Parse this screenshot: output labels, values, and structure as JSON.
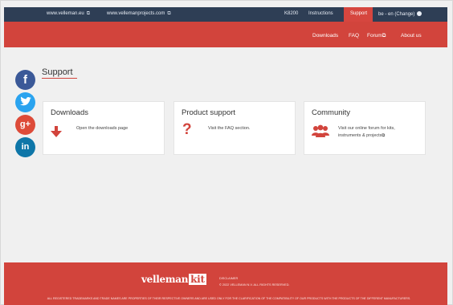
{
  "topbar": {
    "velleman_eu": "www.velleman.eu",
    "velleman_projects": "www.vellemanprojects.com",
    "product_code": "K8200",
    "instructions": "Instructions",
    "support": "Support",
    "language": "be - en (Change)"
  },
  "nav": {
    "downloads": "Downloads",
    "faq": "FAQ",
    "forum": "Forum",
    "about": "About us"
  },
  "page": {
    "title": "Support"
  },
  "cards": {
    "downloads": {
      "title": "Downloads",
      "text": "Open the downloads page"
    },
    "product_support": {
      "title": "Product support",
      "text": "Visit the FAQ section."
    },
    "community": {
      "title": "Community",
      "text": "Visit our online forum for kits, instruments & projects"
    }
  },
  "footer": {
    "logo_text": "velleman",
    "logo_kit": "kit",
    "disclaimer": "DISCLAIMER",
    "copyright": "© 2022 VELLEMAN N.V. ALL RIGHTS RESERVED.",
    "legal": "ALL REGISTERED TRADEMARKS AND TRADE NAMES ARE PROPERTIES OF THEIR RESPECTIVE OWNERS AND ARE USED ONLY FOR THE CLARIFICATION OF THE COMPATIBILITY OF OUR PRODUCTS WITH THE PRODUCTS OF THE DIFFERENT MANUFACTURERS."
  },
  "icons": {
    "facebook": "facebook-icon",
    "twitter": "twitter-icon",
    "googleplus": "google-plus-icon",
    "linkedin": "linkedin-icon",
    "download": "download-arrow-icon",
    "question": "question-icon",
    "community": "community-icon",
    "external": "external-link-icon",
    "globe": "globe-icon"
  },
  "colors": {
    "brand_red": "#d2443c",
    "topbar": "#2e3e55",
    "facebook": "#3b5998",
    "twitter": "#2aa3ef",
    "googleplus": "#dd4b39",
    "linkedin": "#0e76a8"
  }
}
